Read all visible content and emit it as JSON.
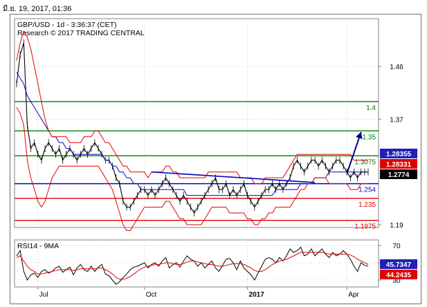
{
  "timestamp": "มี.ย. 19, 2017, 01:36",
  "chart_data": [
    {
      "type": "line",
      "title": "GBP/USD - 1d - 3:36:37 (CET)",
      "subtitle": "Research © 2017 TRADING CENTRAL",
      "price_axis": {
        "ticks": [
          1.46,
          1.37,
          1.19
        ],
        "range": [
          1.165,
          1.51
        ]
      },
      "x_ticks": [
        "Jul",
        "Oct",
        "2017",
        "Apr"
      ],
      "levels": [
        {
          "label": "1.4",
          "value": 1.4,
          "color": "#008000"
        },
        {
          "label": "1.35",
          "value": 1.35,
          "color": "#008000"
        },
        {
          "label": "1.3075",
          "value": 1.3075,
          "color": "#008000"
        },
        {
          "label": "1.254",
          "value": 1.26,
          "color": "#0000c8"
        },
        {
          "label": "1.235",
          "value": 1.235,
          "color": "#e00000"
        },
        {
          "label": "1.1975",
          "value": 1.1975,
          "color": "#e00000"
        }
      ],
      "price_boxes": [
        {
          "label": "1.28355",
          "color": "#2020b8"
        },
        {
          "label": "1.28331",
          "color": "#e00000"
        },
        {
          "label": "1.2774",
          "color": "#000000"
        }
      ],
      "series": [
        {
          "name": "GBP/USD",
          "color": "#000000",
          "x": [
            0,
            1,
            2,
            3,
            4,
            5,
            6,
            7,
            8,
            9,
            10,
            11,
            12,
            13,
            14,
            15,
            16,
            17,
            18,
            19,
            20,
            21,
            22,
            23,
            24,
            25,
            26,
            27,
            28,
            29,
            30,
            31,
            32,
            33,
            34,
            35,
            36,
            37,
            38,
            39,
            40,
            41,
            42,
            43,
            44,
            45,
            46,
            47,
            48,
            49,
            50,
            51,
            52,
            53,
            54,
            55,
            56,
            57,
            58,
            59,
            60,
            61,
            62,
            63,
            64,
            65,
            66,
            67,
            68,
            69,
            70,
            71,
            72,
            73,
            74,
            75,
            76,
            77,
            78,
            79,
            80,
            81,
            82,
            83,
            84,
            85,
            86,
            87,
            88,
            89,
            90,
            91,
            92,
            93,
            94,
            95,
            96,
            97,
            98,
            99
          ],
          "values": [
            1.43,
            1.48,
            1.5,
            1.36,
            1.32,
            1.33,
            1.31,
            1.3,
            1.32,
            1.33,
            1.32,
            1.31,
            1.32,
            1.3,
            1.31,
            1.32,
            1.31,
            1.3,
            1.31,
            1.32,
            1.31,
            1.32,
            1.33,
            1.32,
            1.31,
            1.3,
            1.3,
            1.29,
            1.27,
            1.26,
            1.23,
            1.22,
            1.22,
            1.23,
            1.24,
            1.25,
            1.25,
            1.24,
            1.25,
            1.24,
            1.25,
            1.26,
            1.27,
            1.26,
            1.25,
            1.24,
            1.23,
            1.24,
            1.23,
            1.22,
            1.21,
            1.22,
            1.23,
            1.24,
            1.25,
            1.26,
            1.27,
            1.25,
            1.25,
            1.26,
            1.24,
            1.25,
            1.24,
            1.25,
            1.26,
            1.24,
            1.23,
            1.22,
            1.23,
            1.24,
            1.25,
            1.25,
            1.26,
            1.25,
            1.26,
            1.25,
            1.26,
            1.27,
            1.29,
            1.3,
            1.29,
            1.28,
            1.29,
            1.3,
            1.3,
            1.29,
            1.3,
            1.29,
            1.28,
            1.29,
            1.3,
            1.3,
            1.29,
            1.28,
            1.27,
            1.28,
            1.27,
            1.28,
            1.28,
            1.28
          ]
        },
        {
          "name": "MA",
          "color": "#0000c8",
          "values": [
            1.45,
            1.44,
            1.43,
            1.41,
            1.4,
            1.39,
            1.38,
            1.37,
            1.36,
            1.35,
            1.34,
            1.34,
            1.33,
            1.33,
            1.32,
            1.32,
            1.31,
            1.31,
            1.31,
            1.31,
            1.31,
            1.31,
            1.31,
            1.31,
            1.31,
            1.3,
            1.3,
            1.29,
            1.29,
            1.28,
            1.28,
            1.27,
            1.27,
            1.26,
            1.26,
            1.25,
            1.25,
            1.25,
            1.25,
            1.25,
            1.25,
            1.25,
            1.25,
            1.25,
            1.25,
            1.25,
            1.25,
            1.25,
            1.24,
            1.24,
            1.24,
            1.24,
            1.24,
            1.24,
            1.24,
            1.24,
            1.24,
            1.24,
            1.24,
            1.24,
            1.24,
            1.24,
            1.24,
            1.24,
            1.24,
            1.24,
            1.24,
            1.24,
            1.24,
            1.24,
            1.24,
            1.24,
            1.24,
            1.25,
            1.25,
            1.25,
            1.25,
            1.25,
            1.25,
            1.25,
            1.26,
            1.26,
            1.26,
            1.26,
            1.27,
            1.27,
            1.27,
            1.27,
            1.28,
            1.28,
            1.28,
            1.28,
            1.28,
            1.28,
            1.28,
            1.28,
            1.28,
            1.28,
            1.28,
            1.28
          ]
        },
        {
          "name": "Upper band",
          "color": "#e00000",
          "values": [
            1.47,
            1.5,
            1.52,
            1.51,
            1.49,
            1.46,
            1.43,
            1.4,
            1.37,
            1.35,
            1.34,
            1.34,
            1.34,
            1.34,
            1.34,
            1.33,
            1.33,
            1.33,
            1.33,
            1.34,
            1.34,
            1.34,
            1.35,
            1.35,
            1.34,
            1.33,
            1.33,
            1.32,
            1.31,
            1.3,
            1.29,
            1.29,
            1.28,
            1.28,
            1.28,
            1.28,
            1.28,
            1.27,
            1.28,
            1.28,
            1.28,
            1.28,
            1.29,
            1.29,
            1.28,
            1.28,
            1.27,
            1.27,
            1.27,
            1.27,
            1.27,
            1.27,
            1.27,
            1.27,
            1.28,
            1.28,
            1.28,
            1.28,
            1.28,
            1.28,
            1.28,
            1.28,
            1.28,
            1.27,
            1.27,
            1.27,
            1.27,
            1.26,
            1.26,
            1.26,
            1.27,
            1.27,
            1.27,
            1.27,
            1.27,
            1.27,
            1.28,
            1.29,
            1.3,
            1.31,
            1.31,
            1.31,
            1.31,
            1.31,
            1.31,
            1.31,
            1.31,
            1.31,
            1.31,
            1.31,
            1.31,
            1.31,
            1.31,
            1.31,
            1.31,
            1.3,
            1.3,
            1.3,
            1.3,
            1.3
          ]
        },
        {
          "name": "Lower band",
          "color": "#e00000",
          "values": [
            1.39,
            1.38,
            1.36,
            1.3,
            1.27,
            1.25,
            1.23,
            1.22,
            1.23,
            1.25,
            1.27,
            1.28,
            1.29,
            1.29,
            1.29,
            1.29,
            1.29,
            1.29,
            1.29,
            1.29,
            1.29,
            1.29,
            1.29,
            1.29,
            1.28,
            1.27,
            1.26,
            1.25,
            1.23,
            1.21,
            1.19,
            1.18,
            1.18,
            1.19,
            1.2,
            1.21,
            1.22,
            1.22,
            1.22,
            1.22,
            1.22,
            1.22,
            1.23,
            1.23,
            1.22,
            1.21,
            1.2,
            1.2,
            1.19,
            1.19,
            1.19,
            1.19,
            1.19,
            1.2,
            1.21,
            1.22,
            1.22,
            1.22,
            1.22,
            1.22,
            1.21,
            1.21,
            1.21,
            1.21,
            1.21,
            1.2,
            1.2,
            1.19,
            1.19,
            1.2,
            1.2,
            1.21,
            1.21,
            1.22,
            1.22,
            1.22,
            1.22,
            1.22,
            1.23,
            1.24,
            1.25,
            1.25,
            1.26,
            1.26,
            1.27,
            1.27,
            1.27,
            1.27,
            1.26,
            1.26,
            1.26,
            1.26,
            1.26,
            1.26,
            1.25,
            1.25,
            1.25,
            1.26,
            1.26,
            1.26
          ]
        }
      ],
      "annotations": [
        {
          "type": "trendline",
          "from": [
            38,
            1.28
          ],
          "to": [
            84,
            1.262
          ],
          "color": "#0000c8"
        },
        {
          "type": "arrow",
          "from": [
            93,
            1.277
          ],
          "to": [
            97,
            1.348
          ],
          "color": "#000080"
        }
      ],
      "grid": true
    },
    {
      "type": "line",
      "title": "RSI14 - 9MA",
      "y_ticks": [
        70,
        50,
        30
      ],
      "ylim": [
        20,
        80
      ],
      "value_boxes": [
        {
          "label": "45.7347",
          "color": "#2020b8"
        },
        {
          "label": "44.2435",
          "color": "#e00000"
        }
      ],
      "series": [
        {
          "name": "RSI14",
          "color": "#000000",
          "values": [
            58,
            64,
            40,
            30,
            36,
            38,
            33,
            40,
            42,
            38,
            40,
            44,
            46,
            39,
            42,
            45,
            36,
            44,
            48,
            42,
            40,
            46,
            40,
            45,
            48,
            37,
            35,
            30,
            25,
            28,
            33,
            37,
            42,
            45,
            46,
            48,
            50,
            44,
            48,
            50,
            46,
            52,
            56,
            44,
            48,
            50,
            45,
            52,
            58,
            54,
            52,
            46,
            50,
            44,
            48,
            52,
            44,
            40,
            47,
            54,
            55,
            50,
            42,
            52,
            44,
            40,
            36,
            30,
            38,
            46,
            54,
            56,
            54,
            50,
            56,
            52,
            58,
            66,
            62,
            64,
            68,
            58,
            60,
            66,
            58,
            62,
            66,
            60,
            56,
            62,
            58,
            60,
            64,
            60,
            54,
            46,
            40,
            50,
            47,
            46
          ]
        },
        {
          "name": "9MA",
          "color": "#e00000",
          "values": [
            56,
            58,
            52,
            46,
            42,
            40,
            37,
            37,
            38,
            39,
            40,
            41,
            42,
            42,
            42,
            42,
            41,
            42,
            43,
            43,
            43,
            43,
            43,
            44,
            44,
            42,
            40,
            37,
            33,
            31,
            31,
            32,
            34,
            37,
            40,
            43,
            45,
            46,
            47,
            48,
            48,
            49,
            50,
            50,
            49,
            48,
            48,
            49,
            51,
            52,
            52,
            51,
            50,
            49,
            48,
            48,
            47,
            46,
            46,
            47,
            48,
            49,
            49,
            49,
            48,
            46,
            44,
            41,
            40,
            40,
            42,
            45,
            48,
            50,
            52,
            53,
            54,
            56,
            58,
            60,
            62,
            62,
            62,
            62,
            62,
            62,
            62,
            61,
            60,
            60,
            60,
            60,
            60,
            60,
            59,
            57,
            54,
            52,
            50,
            48
          ]
        }
      ],
      "grid": true
    }
  ]
}
